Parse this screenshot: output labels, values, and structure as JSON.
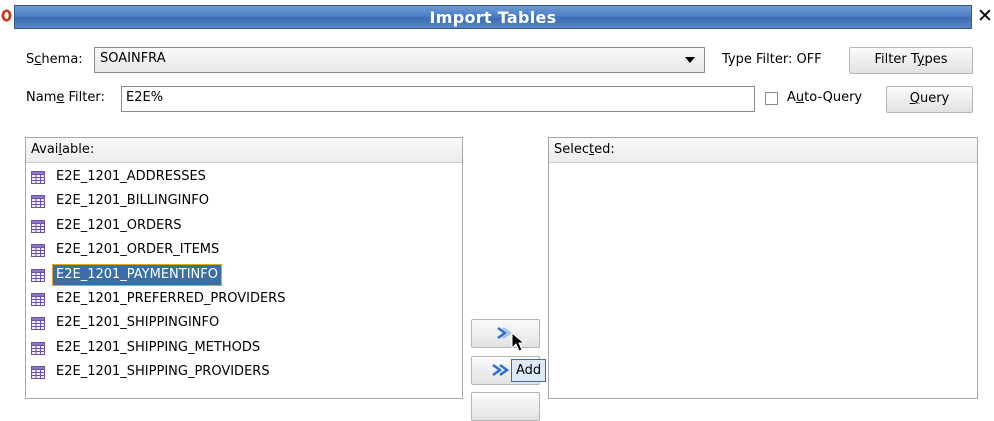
{
  "window": {
    "title": "Import Tables"
  },
  "schema": {
    "label_pre": "S",
    "label_acc": "c",
    "label_post": "hema:",
    "value": "SOAINFRA"
  },
  "type_filter": {
    "status": "Type Filter: OFF",
    "button_pre": "Filter T",
    "button_acc": "y",
    "button_post": "pes"
  },
  "name_filter": {
    "label_pre": "Nam",
    "label_acc": "e",
    "label_post": " Filter:",
    "value": "E2E%"
  },
  "auto_query": {
    "pre": "A",
    "acc": "u",
    "post": "to-Query",
    "checked": false
  },
  "query_button": {
    "acc": "Q",
    "post": "uery"
  },
  "available": {
    "header_pre": "Avai",
    "header_acc": "l",
    "header_post": "able:",
    "items": [
      "E2E_1201_ADDRESSES",
      "E2E_1201_BILLINGINFO",
      "E2E_1201_ORDERS",
      "E2E_1201_ORDER_ITEMS",
      "E2E_1201_PAYMENTINFO",
      "E2E_1201_PREFERRED_PROVIDERS",
      "E2E_1201_SHIPPINGINFO",
      "E2E_1201_SHIPPING_METHODS",
      "E2E_1201_SHIPPING_PROVIDERS"
    ],
    "selected_item": "E2E_1201_PAYMENTINFO"
  },
  "selected": {
    "header_pre": "Selec",
    "header_acc": "t",
    "header_post": "ed:"
  },
  "tooltip": {
    "text": "Add"
  },
  "colors": {
    "title_bar": "#4d7fc3",
    "selection": "#3a6ea5",
    "focus_outline": "#e6a51a",
    "move_arrow": "#2b6fd6"
  }
}
